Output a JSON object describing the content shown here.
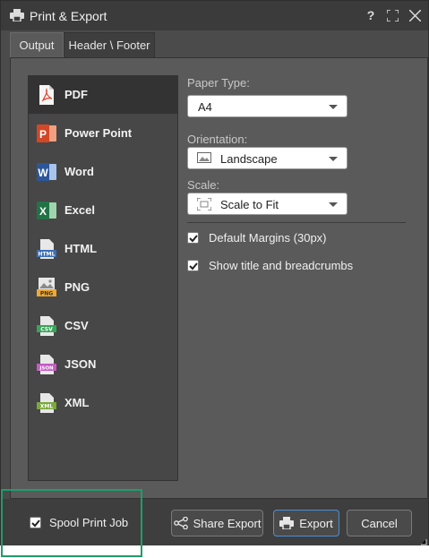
{
  "window": {
    "title": "Print & Export",
    "help_label": "?"
  },
  "tabs": [
    {
      "label": "Output",
      "active": true
    },
    {
      "label": "Header \\ Footer",
      "active": false
    }
  ],
  "formats": [
    {
      "label": "PDF",
      "icon": "pdf-icon",
      "selected": true
    },
    {
      "label": "Power Point",
      "icon": "powerpoint-icon"
    },
    {
      "label": "Word",
      "icon": "word-icon"
    },
    {
      "label": "Excel",
      "icon": "excel-icon"
    },
    {
      "label": "HTML",
      "icon": "html-file-icon",
      "icon_text": "HTML"
    },
    {
      "label": "PNG",
      "icon": "png-image-icon",
      "icon_text": "PNG"
    },
    {
      "label": "CSV",
      "icon": "csv-file-icon",
      "icon_text": "CSV"
    },
    {
      "label": "JSON",
      "icon": "json-file-icon",
      "icon_text": "JSON"
    },
    {
      "label": "XML",
      "icon": "xml-file-icon",
      "icon_text": "XML"
    }
  ],
  "options": {
    "paper_type": {
      "label": "Paper Type:",
      "value": "A4"
    },
    "orientation": {
      "label": "Orientation:",
      "value": "Landscape"
    },
    "scale": {
      "label": "Scale:",
      "value": "Scale to Fit"
    },
    "default_margins": {
      "label": "Default Margins (30px)",
      "checked": true
    },
    "show_title": {
      "label": "Show title and breadcrumbs",
      "checked": true
    }
  },
  "footer": {
    "spool": {
      "label": "Spool Print Job",
      "checked": true
    },
    "share_label": "Share Export",
    "export_label": "Export",
    "cancel_label": "Cancel"
  },
  "colors": {
    "pdf": "#e0412b",
    "powerpoint": "#d24726",
    "word": "#2b579a",
    "excel": "#217346",
    "html": "#3b6fb6",
    "png": "#f0a830",
    "csv": "#3aa35a",
    "json": "#c45ac4",
    "xml": "#7aa83a",
    "highlight": "#1f9d6b",
    "primary_border": "#4a8fd8"
  }
}
